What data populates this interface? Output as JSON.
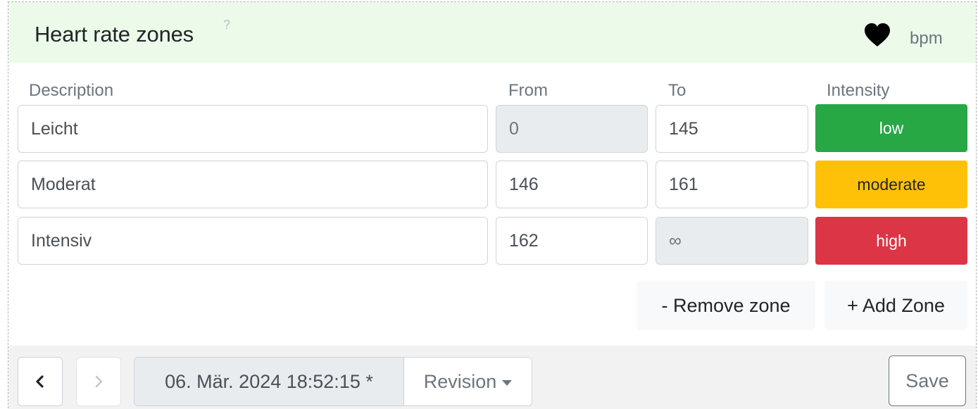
{
  "header": {
    "title": "Heart rate zones",
    "help_mark": "?",
    "icon": "heart-icon",
    "unit": "bpm"
  },
  "columns": {
    "description": "Description",
    "from": "From",
    "to": "To",
    "intensity": "Intensity"
  },
  "zones": [
    {
      "description": "Leicht",
      "from": "0",
      "to": "145",
      "intensity": "low",
      "intensity_color": "#28a745",
      "intensity_text_color": "#ffffff",
      "from_disabled": true,
      "to_disabled": false
    },
    {
      "description": "Moderat",
      "from": "146",
      "to": "161",
      "intensity": "moderate",
      "intensity_color": "#ffc107",
      "intensity_text_color": "#212529",
      "from_disabled": false,
      "to_disabled": false
    },
    {
      "description": "Intensiv",
      "from": "162",
      "to": "∞",
      "intensity": "high",
      "intensity_color": "#dc3545",
      "intensity_text_color": "#ffffff",
      "from_disabled": false,
      "to_disabled": true
    }
  ],
  "actions": {
    "remove_zone": "- Remove zone",
    "add_zone": "+ Add Zone"
  },
  "footer": {
    "prev_icon": "chevron-left-icon",
    "next_icon": "chevron-right-icon",
    "revision_date": "06. Mär. 2024 18:52:15 *",
    "revision_label": "Revision",
    "save_label": "Save"
  },
  "colors": {
    "header_bg": "#ecfaea",
    "footer_bg": "#f2f2f2"
  }
}
